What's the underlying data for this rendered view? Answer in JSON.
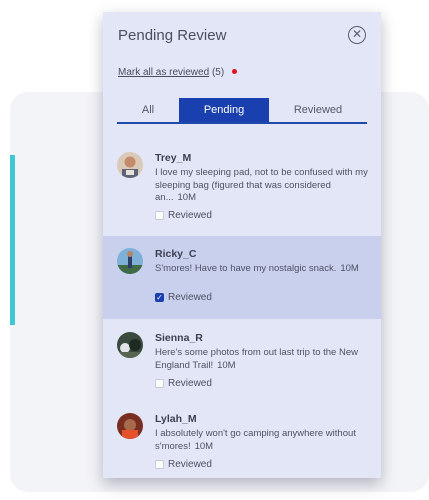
{
  "panel": {
    "title": "Pending Review",
    "close_icon": "close-circle-icon",
    "mark_all_label": "Mark all as reviewed",
    "mark_all_count": "(5)",
    "colors": {
      "accent": "#1a3fae",
      "unread_dot": "#e10f1c",
      "highlight": "#c8d0ee"
    }
  },
  "tabs": [
    {
      "label": "All",
      "active": false
    },
    {
      "label": "Pending",
      "active": true
    },
    {
      "label": "Reviewed",
      "active": false
    }
  ],
  "items": [
    {
      "username": "Trey_M",
      "message": "I love my sleeping pad, not to be confused with my sleeping bag (figured that was considered an...",
      "time": "10M",
      "reviewed_label": "Reviewed",
      "reviewed": false,
      "highlighted": false
    },
    {
      "username": "Ricky_C",
      "message": "S'mores! Have to have my nostalgic snack.",
      "time": "10M",
      "reviewed_label": "Reviewed",
      "reviewed": true,
      "highlighted": true
    },
    {
      "username": "Sienna_R",
      "message": "Here's some photos from out last trip to the New England Trail!",
      "time": "10M",
      "reviewed_label": "Reviewed",
      "reviewed": false,
      "highlighted": false
    },
    {
      "username": "Lylah_M",
      "message": "I absolutely won't go camping anywhere without s'mores!",
      "time": "10M",
      "reviewed_label": "Reviewed",
      "reviewed": false,
      "highlighted": false
    }
  ]
}
